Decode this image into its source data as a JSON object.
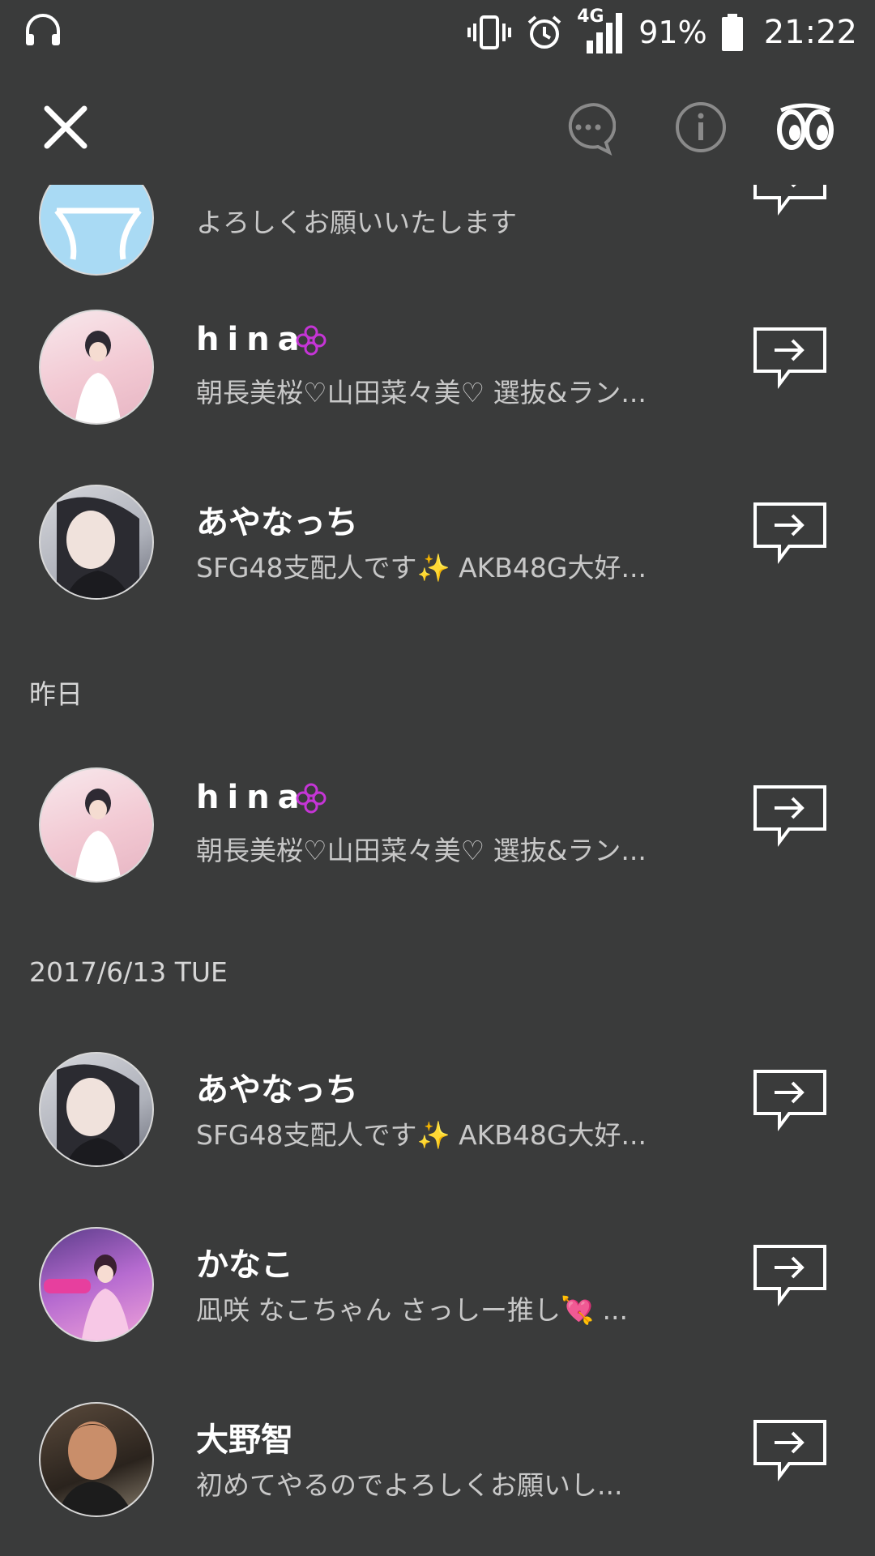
{
  "status_bar": {
    "battery_percent": "91%",
    "network": "4G",
    "time": "21:22",
    "icons": [
      "headset-icon",
      "vibrate-icon",
      "alarm-icon",
      "signal-icon",
      "battery-icon"
    ]
  },
  "top_bar": {
    "icons": [
      "close-icon",
      "chat-bubble-icon",
      "info-icon",
      "eyes-icon"
    ]
  },
  "list": {
    "rows": [
      {
        "name": "",
        "message": "よろしくお願いいたします"
      },
      {
        "name": "hina",
        "message": "朝長美桜♡山田菜々美♡ 選抜&ラン..."
      },
      {
        "name": "あやなっち",
        "message": "SFG48支配人です✨ AKB48G大好..."
      },
      {
        "name": "hina",
        "message": "朝長美桜♡山田菜々美♡ 選抜&ラン..."
      },
      {
        "name": "あやなっち",
        "message": "SFG48支配人です✨ AKB48G大好..."
      },
      {
        "name": "かなこ",
        "message": "凪咲 なこちゃん さっしー推し💘 ..."
      },
      {
        "name": "大野智",
        "message": "初めてやるのでよろしくお願いし..."
      }
    ],
    "sections": [
      {
        "label": "昨日"
      },
      {
        "label": "2017/6/13 TUE"
      }
    ]
  }
}
